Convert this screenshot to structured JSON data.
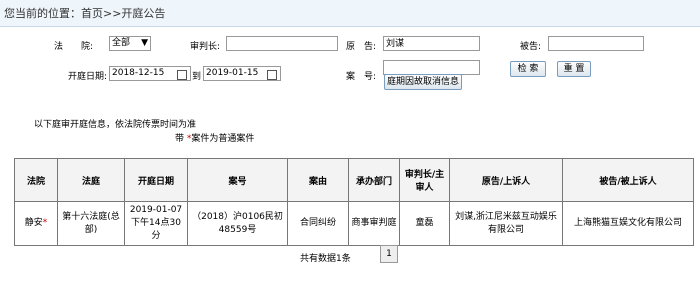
{
  "header": {
    "location": "您当前的位置：首页>>开庭公告"
  },
  "form": {
    "court_label": "法　　院:",
    "court_value": "全部",
    "judge_label": "审判长:",
    "judge_value": "",
    "plaintiff_label": "原　告:",
    "plaintiff_value": "刘谋",
    "defendant_label": "被告:",
    "defendant_value": "",
    "date_label": "开庭日期:",
    "date_from": "2018-12-15",
    "date_to_label": "到",
    "date_to": "2019-01-15",
    "case_label": "案　号:",
    "case_value": "",
    "search_button": "检 索",
    "reset_button": "重 置",
    "cancel_button": "庭期因故取消信息"
  },
  "notes": {
    "line1": "以下庭审开庭信息，依法院传票时间为准",
    "line2_prefix": "带",
    "line2_star": "*",
    "line2_suffix": "案件为普通案件"
  },
  "table": {
    "headers": [
      "法院",
      "法庭",
      "开庭日期",
      "案号",
      "案由",
      "承办部门",
      "审判长/主审人",
      "原告/上诉人",
      "被告/被上诉人"
    ],
    "rows": [
      {
        "court": "静安",
        "court_star": "*",
        "tribunal": "第十六法庭(总部)",
        "date": "2019-01-07下午14点30分",
        "case_no": "（2018）沪0106民初48559号",
        "cause": "合同纠纷",
        "dept": "商事审判庭",
        "judge": "童磊",
        "plaintiff": "刘谋,浙江尼米兹互动娱乐有限公司",
        "defendant": "上海熊猫互娱文化有限公司"
      }
    ]
  },
  "pager": {
    "summary": "共有数据1条",
    "page": "1"
  }
}
